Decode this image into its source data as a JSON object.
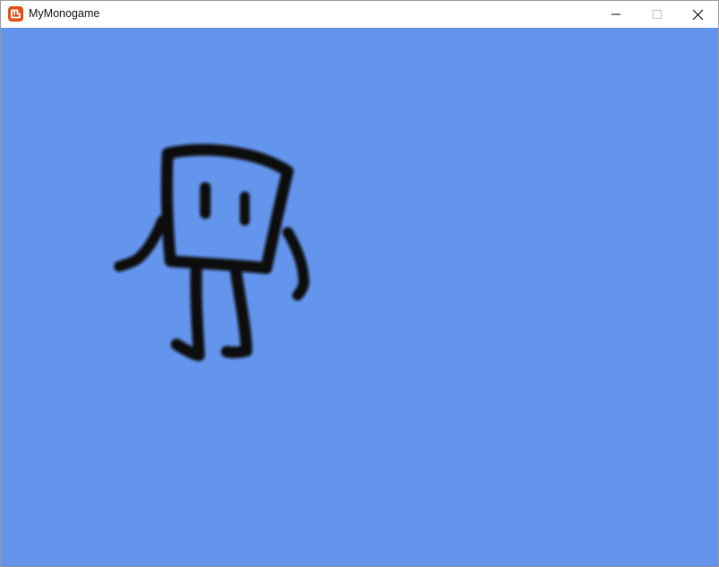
{
  "window": {
    "title": "MyMonogame",
    "app_icon": "monogame-logo-icon",
    "controls": {
      "minimize_icon": "minimize-icon",
      "maximize_icon": "maximize-icon",
      "close_icon": "close-icon"
    }
  },
  "game": {
    "background_color": "#6495ED",
    "sprite": "doodle-box-character"
  },
  "colors": {
    "accent_icon": "#E0541B",
    "ink": "#0d0d0d"
  }
}
